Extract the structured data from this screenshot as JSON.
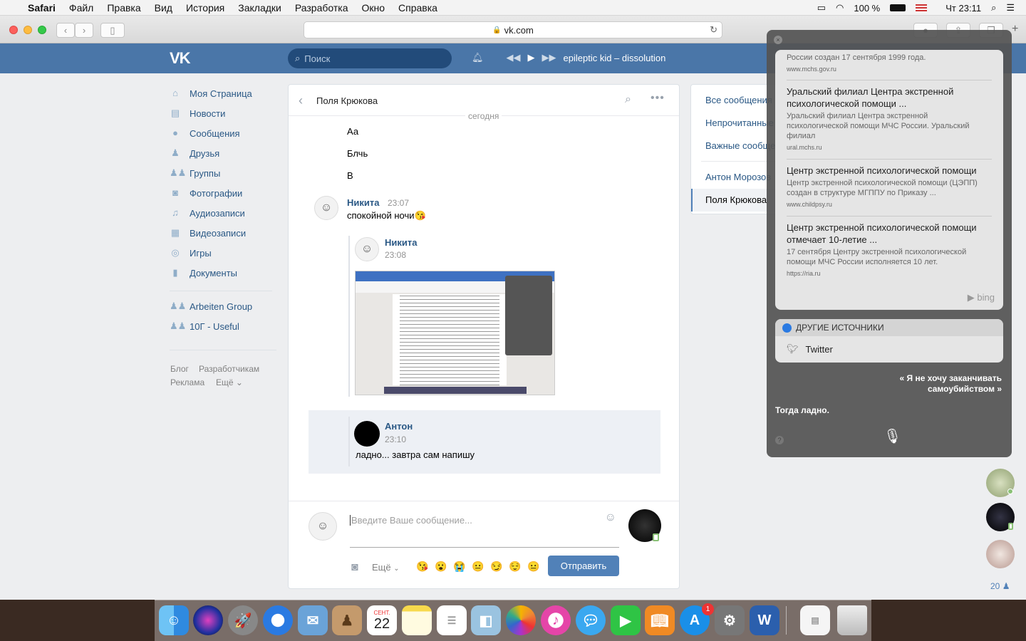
{
  "menubar": {
    "apple": "",
    "app": "Safari",
    "items": [
      "Файл",
      "Правка",
      "Вид",
      "История",
      "Закладки",
      "Разработка",
      "Окно",
      "Справка"
    ],
    "battery": "100 %",
    "clock": "Чт 23:11"
  },
  "browser": {
    "url": "vk.com"
  },
  "vk": {
    "logo": "VK",
    "search_placeholder": "Поиск",
    "player_track": "epileptic kid – dissolution",
    "nav": [
      "Моя Страница",
      "Новости",
      "Сообщения",
      "Друзья",
      "Группы",
      "Фотографии",
      "Аудиозаписи",
      "Видеозаписи",
      "Игры",
      "Документы"
    ],
    "groups": [
      "Arbeiten Group",
      "10Г - Useful"
    ],
    "footer": {
      "blog": "Блог",
      "devs": "Разработчикам",
      "ads": "Реклама",
      "more": "Ещё"
    }
  },
  "chat": {
    "title": "Поля Крюкова",
    "date_sep": "сегодня",
    "plain": [
      "Аа",
      "Блчь",
      "В"
    ],
    "msg1": {
      "author": "Никита",
      "time": "23:07",
      "text": "спокойной ночи😘"
    },
    "fwd1": {
      "author": "Никита",
      "time": "23:08"
    },
    "fwd2": {
      "author": "Антон",
      "time": "23:10",
      "text": "ладно... завтра сам напишу"
    },
    "input_placeholder": "Введите Ваше сообщение...",
    "more": "Ещё",
    "send": "Отправить",
    "emojis": [
      "😘",
      "😮",
      "😭",
      "😐",
      "😏",
      "😌",
      "😐"
    ]
  },
  "dialogs": [
    "Все сообщения",
    "Непрочитанные",
    "Важные сообщения",
    "Антон Морозов",
    "Поля Крюкова"
  ],
  "friends_count": "20",
  "siri": {
    "results": [
      {
        "title": "",
        "desc": "России создан 17 сентября 1999 года.",
        "url": "www.mchs.gov.ru"
      },
      {
        "title": "Уральский филиал Центра экстренной психологической помощи ...",
        "desc": "Уральский филиал Центра экстренной психологической помощи МЧС России. Уральский филиал",
        "url": "ural.mchs.ru"
      },
      {
        "title": "Центр экстренной психологической помощи",
        "desc": "Центр экстренной психологической помощи (ЦЭПП) создан в структуре МГППУ по Приказу ...",
        "url": "www.childpsy.ru"
      },
      {
        "title": "Центр экстренной психологической помощи отмечает 10-летие ...",
        "desc": "17 сентября Центру экстренной психологической помощи МЧС России исполняется 10 лет.",
        "url": "https://ria.ru"
      }
    ],
    "bing": "bing",
    "other_sources": "ДРУГИЕ ИСТОЧНИКИ",
    "twitter": "Twitter",
    "query": "« Я не хочу заканчивать самоубийством »",
    "answer": "Тогда ладно."
  },
  "dock": {
    "calendar_month": "СЕНТ.",
    "calendar_day": "22",
    "appstore_badge": "1"
  }
}
